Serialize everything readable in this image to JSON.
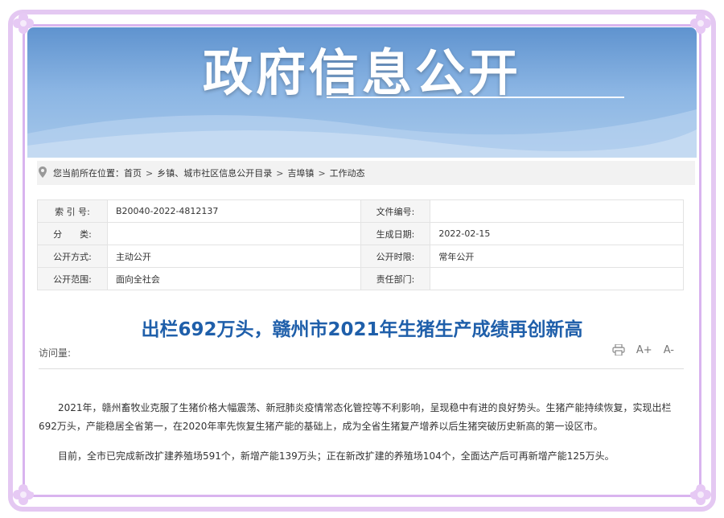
{
  "banner": {
    "title": "政府信息公开"
  },
  "breadcrumb": {
    "label": "您当前所在位置：",
    "items": [
      "首页",
      "乡镇、城市社区信息公开目录",
      "吉埠镇",
      "工作动态"
    ],
    "separator": ">"
  },
  "meta": {
    "index_label": "索 引 号:",
    "index_value": "B20040-2022-4812137",
    "doc_no_label": "文件编号:",
    "doc_no_value": "",
    "category_label": "分　　类:",
    "category_value": "",
    "date_label": "生成日期:",
    "date_value": "2022-02-15",
    "mode_label": "公开方式:",
    "mode_value": "主动公开",
    "period_label": "公开时限:",
    "period_value": "常年公开",
    "scope_label": "公开范围:",
    "scope_value": "面向全社会",
    "dept_label": "责任部门:",
    "dept_value": ""
  },
  "article": {
    "title": "出栏692万头，赣州市2021年生猪生产成绩再创新高",
    "visits_label": "访问量:",
    "paragraphs": [
      "2021年，赣州畜牧业克服了生猪价格大幅震荡、新冠肺炎疫情常态化管控等不利影响，呈现稳中有进的良好势头。生猪产能持续恢复，实现出栏692万头，产能稳居全省第一，在2020年率先恢复生猪产能的基础上，成为全省生猪复产增养以后生猪突破历史新高的第一设区市。",
      "目前，全市已完成新改扩建养殖场591个，新增产能139万头；正在新改扩建的养殖场104个，全面达产后可再新增产能125万头。"
    ]
  },
  "tools": {
    "print_icon": "printer-icon",
    "font_up": "A+",
    "font_down": "A-"
  },
  "colors": {
    "frame": "#d9b4ef",
    "banner": "#6c9bd4",
    "title": "#1f5faa"
  }
}
